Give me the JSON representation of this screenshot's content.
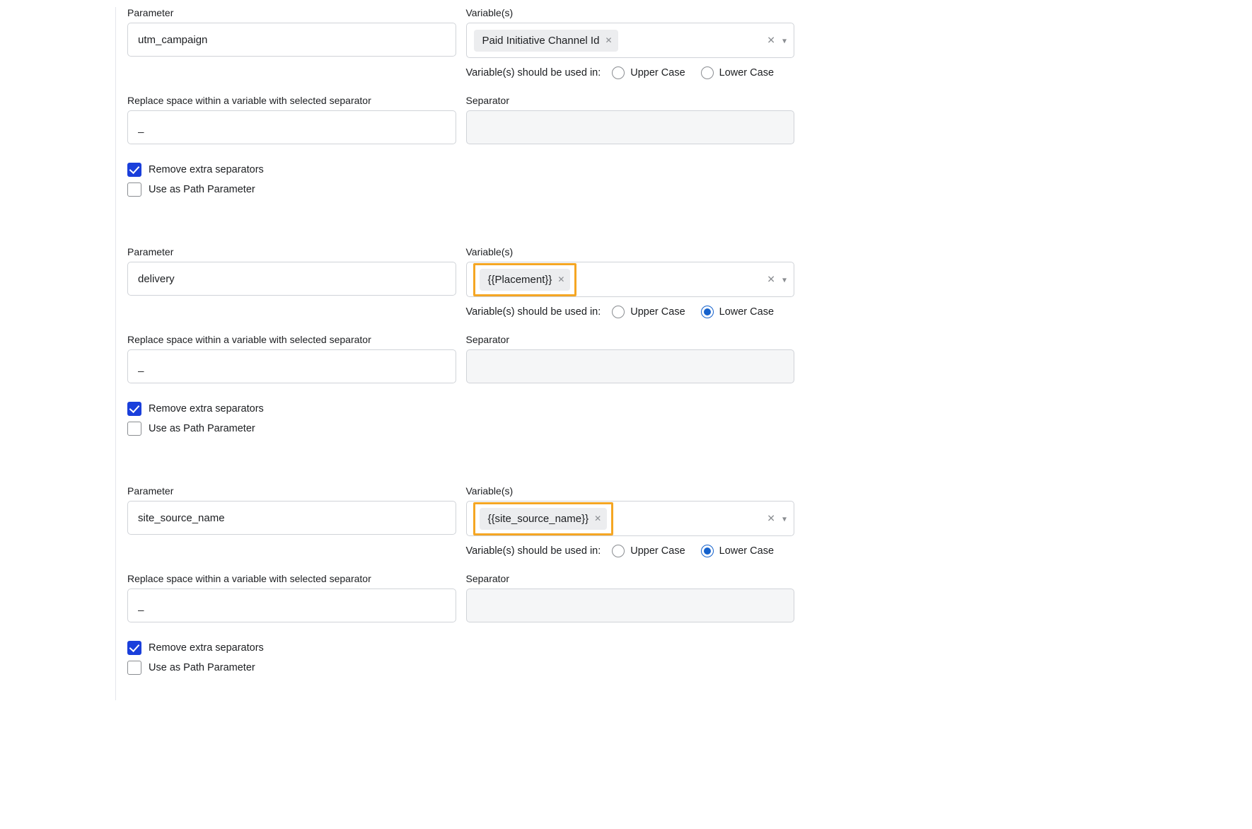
{
  "labels": {
    "parameter": "Parameter",
    "variables": "Variable(s)",
    "case_caption": "Variable(s) should be used in:",
    "upper": "Upper Case",
    "lower": "Lower Case",
    "replace_space": "Replace space within a variable with selected separator",
    "separator": "Separator",
    "remove_extra": "Remove extra separators",
    "path_param": "Use as Path Parameter",
    "underscore": "_"
  },
  "blocks": [
    {
      "parameter": "utm_campaign",
      "tag": "Paid Initiative Channel Id",
      "highlight": false,
      "case": "none",
      "replace_value": "_",
      "separator": "",
      "remove_extra": true,
      "path_param": false
    },
    {
      "parameter": "delivery",
      "tag": "{{Placement}}",
      "highlight": true,
      "case": "lower",
      "replace_value": "_",
      "separator": "",
      "remove_extra": true,
      "path_param": false
    },
    {
      "parameter": "site_source_name",
      "tag": "{{site_source_name}}",
      "highlight": true,
      "case": "lower",
      "replace_value": "_",
      "separator": "",
      "remove_extra": true,
      "path_param": false
    }
  ]
}
